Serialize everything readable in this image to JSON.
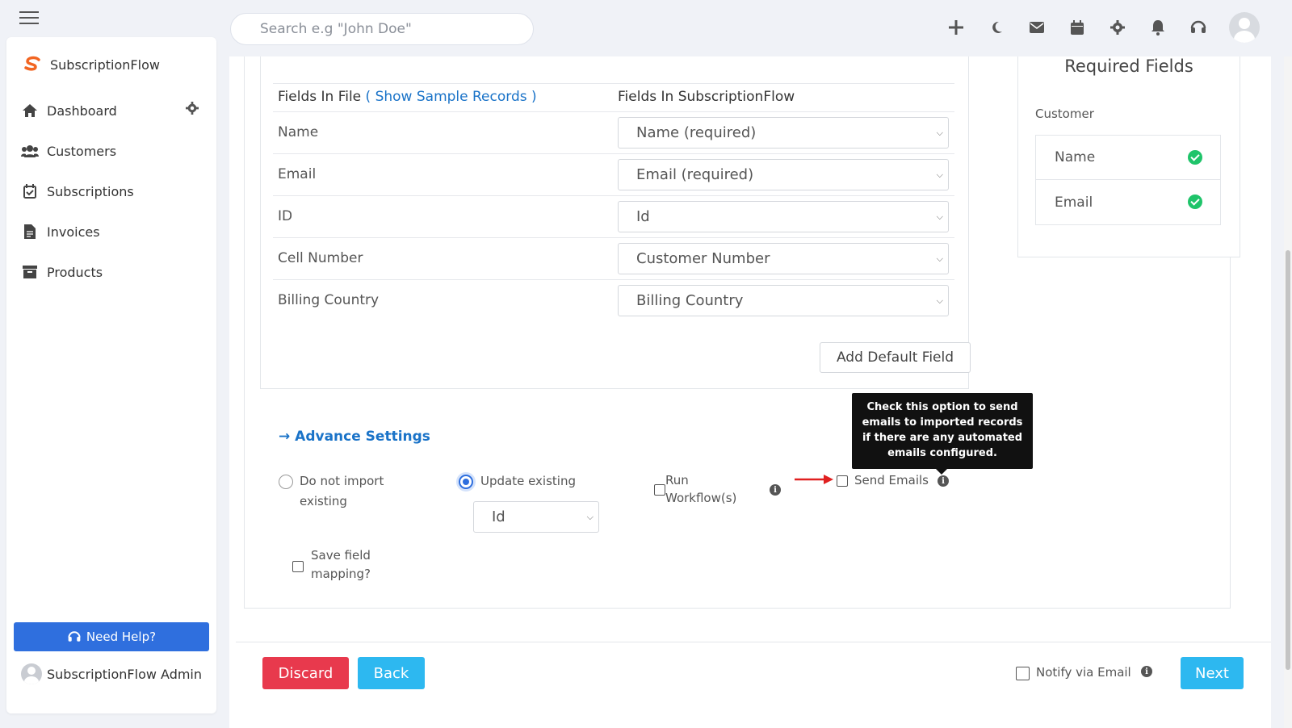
{
  "topbar": {
    "search_placeholder": "Search e.g \"John Doe\"",
    "icons": [
      "plus-icon",
      "moon-icon",
      "mail-icon",
      "calendar-icon",
      "gear-icon",
      "bell-icon",
      "headset-icon",
      "avatar"
    ]
  },
  "sidebar": {
    "brand": "SubscriptionFlow",
    "items": [
      {
        "label": "Dashboard",
        "icon": "home-icon"
      },
      {
        "label": "Customers",
        "icon": "users-icon"
      },
      {
        "label": "Subscriptions",
        "icon": "calendar-check-icon"
      },
      {
        "label": "Invoices",
        "icon": "invoice-icon"
      },
      {
        "label": "Products",
        "icon": "box-icon"
      }
    ],
    "need_help": "Need Help?",
    "admin_name": "SubscriptionFlow Admin"
  },
  "mapping": {
    "header_file": "Fields In File",
    "show_sample": "( Show Sample Records )",
    "header_sf": "Fields In SubscriptionFlow",
    "rows": [
      {
        "field": "Name",
        "mapped": "Name (required)"
      },
      {
        "field": "Email",
        "mapped": "Email (required)"
      },
      {
        "field": "ID",
        "mapped": "Id"
      },
      {
        "field": "Cell Number",
        "mapped": "Customer Number"
      },
      {
        "field": "Billing Country",
        "mapped": "Billing Country"
      }
    ],
    "add_default": "Add Default Field"
  },
  "advance": {
    "title": "Advance Settings",
    "do_not_import": "Do not import existing",
    "update_existing": "Update existing",
    "update_key": "Id",
    "run_workflow": "Run Workflow(s)",
    "send_emails": "Send Emails",
    "save_mapping": "Save field mapping?",
    "tooltip": "Check this option to send emails to imported records if there are any automated emails configured."
  },
  "required": {
    "title": "Required Fields",
    "subtitle": "Customer",
    "items": [
      "Name",
      "Email"
    ]
  },
  "footer": {
    "discard": "Discard",
    "back": "Back",
    "notify": "Notify via Email",
    "next": "Next"
  },
  "colors": {
    "accent_blue": "#2f6fde",
    "link_blue": "#1a73c8",
    "discard_red": "#e8394d",
    "cyan_button": "#2db8f0",
    "check_green": "#1fc46a",
    "arrow_red": "#e02020"
  }
}
